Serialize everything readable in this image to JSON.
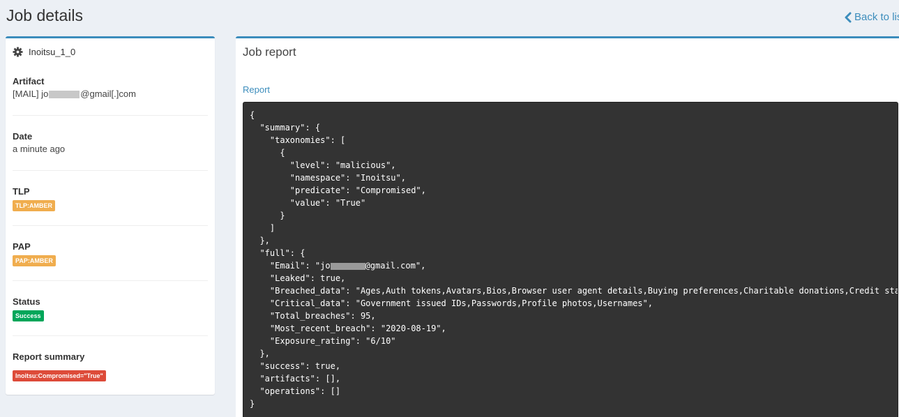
{
  "header": {
    "title": "Job details",
    "back_label": "Back to lis"
  },
  "sidebar": {
    "analyzer_name": "Inoitsu_1_0",
    "artifact": {
      "label": "Artifact",
      "prefix": "[MAIL] jo",
      "suffix": "@gmail[.]com"
    },
    "date": {
      "label": "Date",
      "value": "a minute ago"
    },
    "tlp": {
      "label": "TLP",
      "badge": "TLP:AMBER"
    },
    "pap": {
      "label": "PAP",
      "badge": "PAP:AMBER"
    },
    "status": {
      "label": "Status",
      "badge": "Success"
    },
    "report_summary": {
      "label": "Report summary",
      "badge": "Inoitsu:Compromised=\"True\""
    }
  },
  "main": {
    "title": "Job report",
    "tab": "Report",
    "report_lines": [
      "{",
      "  \"summary\": {",
      "    \"taxonomies\": [",
      "      {",
      "        \"level\": \"malicious\",",
      "        \"namespace\": \"Inoitsu\",",
      "        \"predicate\": \"Compromised\",",
      "        \"value\": \"True\"",
      "      }",
      "    ]",
      "  },",
      "  \"full\": {",
      "    \"Email\": \"jo",
      "    \"Leaked\": true,",
      "    \"Breached_data\": \"Ages,Auth tokens,Avatars,Bios,Browser user agent details,Buying preferences,Charitable donations,Credit stat",
      "    \"Critical_data\": \"Government issued IDs,Passwords,Profile photos,Usernames\",",
      "    \"Total_breaches\": 95,",
      "    \"Most_recent_breach\": \"2020-08-19\",",
      "    \"Exposure_rating\": \"6/10\"",
      "  },",
      "  \"success\": true,",
      "  \"artifacts\": [],",
      "  \"operations\": []",
      "}"
    ],
    "email_suffix": "@gmail.com\","
  },
  "colors": {
    "accent": "#3c8dbc",
    "amber": "#f0ad4e",
    "success": "#00a65a",
    "danger": "#dd4b39",
    "code_bg": "#333333"
  }
}
